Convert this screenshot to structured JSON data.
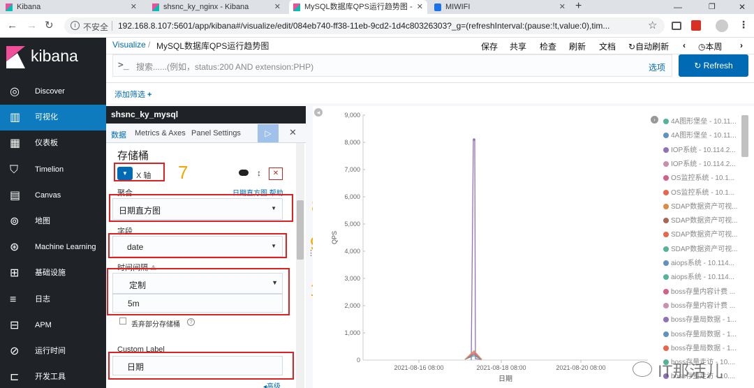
{
  "browser": {
    "tabs": [
      {
        "label": "Kibana"
      },
      {
        "label": "shsnc_ky_nginx - Kibana"
      },
      {
        "label": "MySQL数据库QPS运行趋势图 -"
      },
      {
        "label": "MIWIFI"
      }
    ],
    "url_security": "不安全",
    "url": "192.168.8.107:5601/app/kibana#/visualize/edit/084eb740-ff38-11eb-9cd2-1d4c80326303?_g=(refreshInterval:(pause:!t,value:0),tim..."
  },
  "sidebar": {
    "logo_text": "kibana",
    "items": [
      {
        "label": "Discover"
      },
      {
        "label": "可视化"
      },
      {
        "label": "仪表板"
      },
      {
        "label": "Timelion"
      },
      {
        "label": "Canvas"
      },
      {
        "label": "地图"
      },
      {
        "label": "Machine Learning"
      },
      {
        "label": "基础设施"
      },
      {
        "label": "日志"
      },
      {
        "label": "APM"
      },
      {
        "label": "运行时间"
      },
      {
        "label": "开发工具"
      }
    ]
  },
  "header": {
    "breadcrumb_root": "Visualize",
    "breadcrumb_sep": "/",
    "breadcrumb_current": "MySQL数据库QPS运行趋势图",
    "actions": [
      "保存",
      "共享",
      "检查",
      "刷新",
      "文档"
    ],
    "auto_refresh": "自动刷新",
    "time_label": "本周",
    "search_prompt": ">_",
    "search_placeholder": "搜索......(例如，status:200 AND extension:PHP)",
    "options_label": "选项",
    "refresh_label": "Refresh",
    "add_filter": "添加筛选"
  },
  "editor": {
    "index_title": "shsnc_ky_mysql",
    "tabs": [
      "数据",
      "Metrics & Axes",
      "Panel Settings"
    ],
    "bucket_title": "存储桶",
    "bucket_type": "X 轴",
    "agg_label": "聚合",
    "agg_help": "日期直方图 帮助",
    "agg_value": "日期直方图",
    "field_label": "字段",
    "field_value": "date",
    "interval_label": "时间间隔",
    "interval_value": "定制",
    "interval_custom": "5m",
    "drop_partial": "丢弃部分存储桶",
    "custom_label_title": "Custom Label",
    "custom_label_value": "日期",
    "advanced": "高级"
  },
  "annotations": [
    "7",
    "8",
    "9",
    "10",
    "11"
  ],
  "chart_data": {
    "type": "line",
    "ylabel": "QPS",
    "xlabel": "日期",
    "ylim": [
      0,
      9000
    ],
    "y_ticks": [
      "0",
      "1,000",
      "2,000",
      "3,000",
      "4,000",
      "5,000",
      "6,000",
      "7,000",
      "8,000",
      "9,000"
    ],
    "x_ticks": [
      "2021-08-16 08:00",
      "2021-08-18 08:00",
      "2021-08-20 08:00"
    ],
    "spike_value": 8100,
    "legend": [
      {
        "name": "4A图形堡垒 - 10.11...",
        "color": "#54b399"
      },
      {
        "name": "4A图形堡垒 - 10.11...",
        "color": "#6092c0"
      },
      {
        "name": "IOP系统 - 10.114.2...",
        "color": "#9170b8"
      },
      {
        "name": "IOP系统 - 10.114.2...",
        "color": "#ca8eae"
      },
      {
        "name": "OS监控系统 - 10.1...",
        "color": "#d36086"
      },
      {
        "name": "OS监控系统 - 10.1...",
        "color": "#e7664c"
      },
      {
        "name": "SDAP数据资产可视...",
        "color": "#da8b45"
      },
      {
        "name": "SDAP数据资产可视...",
        "color": "#aa6556"
      },
      {
        "name": "SDAP数据资产可视...",
        "color": "#e7664c"
      },
      {
        "name": "SDAP数据资产可视...",
        "color": "#54b399"
      },
      {
        "name": "aiops系统 - 10.114...",
        "color": "#6092c0"
      },
      {
        "name": "aiops系统 - 10.114...",
        "color": "#54b399"
      },
      {
        "name": "boss存量内容计费 ...",
        "color": "#d36086"
      },
      {
        "name": "boss存量内容计费 ...",
        "color": "#ca8eae"
      },
      {
        "name": "boss存量局数据 - 1...",
        "color": "#9170b8"
      },
      {
        "name": "boss存量局数据 - 1...",
        "color": "#6092c0"
      },
      {
        "name": "boss存量局数据 - 1...",
        "color": "#e7664c"
      },
      {
        "name": "boss存量走访 - 10....",
        "color": "#54b399"
      },
      {
        "name": "boss存量走访 - 10....",
        "color": "#9170b8"
      }
    ]
  },
  "watermark": "IT那活儿"
}
